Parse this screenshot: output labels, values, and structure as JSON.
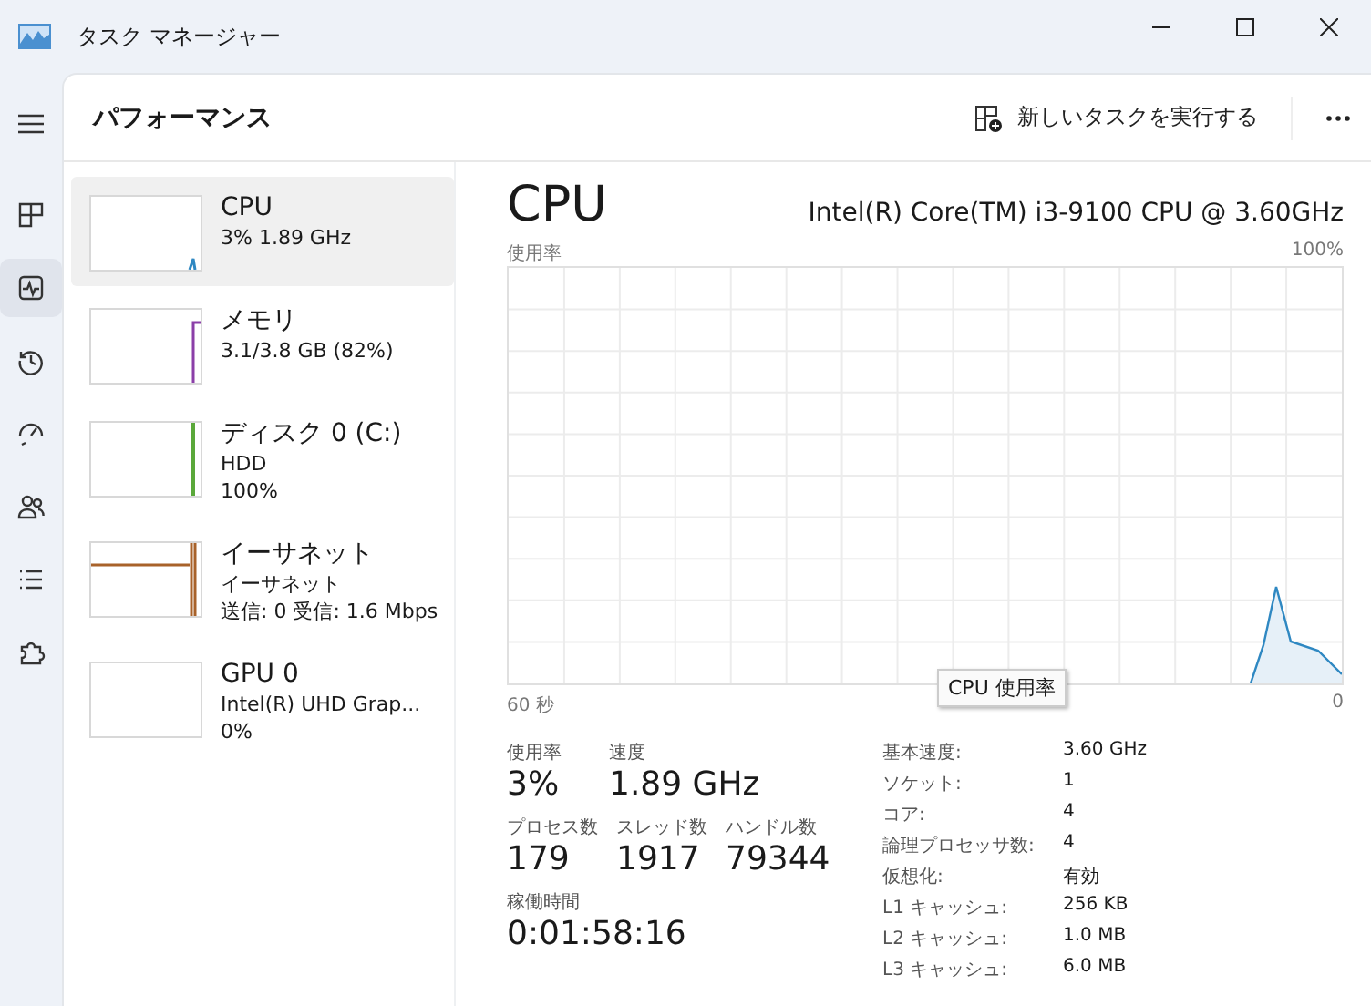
{
  "window": {
    "title": "タスク マネージャー"
  },
  "nav": [
    {
      "selected": false
    },
    {
      "selected": true
    },
    {
      "selected": false
    },
    {
      "selected": false
    },
    {
      "selected": false
    },
    {
      "selected": false
    },
    {
      "selected": false
    }
  ],
  "header": {
    "title": "パフォーマンス",
    "run_task": "新しいタスクを実行する"
  },
  "devices": [
    {
      "kind": "cpu",
      "name": "CPU",
      "lines": [
        "3%  1.89 GHz"
      ],
      "color": "#2f88c2",
      "selected": true
    },
    {
      "kind": "memory",
      "name": "メモリ",
      "lines": [
        "3.1/3.8 GB (82%)"
      ],
      "color": "#8b3fa8",
      "selected": false
    },
    {
      "kind": "disk",
      "name": "ディスク 0 (C:)",
      "lines": [
        "HDD",
        "100%"
      ],
      "color": "#5aa83a",
      "selected": false
    },
    {
      "kind": "ethernet",
      "name": "イーサネット",
      "lines": [
        "イーサネット",
        "送信: 0 受信: 1.6 Mbps"
      ],
      "color": "#a8622a",
      "selected": false
    },
    {
      "kind": "gpu",
      "name": "GPU 0",
      "lines": [
        "Intel(R) UHD Grap...",
        "0%"
      ],
      "selected": false
    }
  ],
  "detail": {
    "title": "CPU",
    "model": "Intel(R) Core(TM) i3-9100 CPU @ 3.60GHz",
    "graph": {
      "label": "使用率",
      "max_label": "100%",
      "time_label": "60 秒",
      "min_label": "0",
      "tooltip": "CPU 使用率"
    },
    "stat_rows": [
      {
        "items": [
          {
            "label": "使用率",
            "value": "3%"
          },
          {
            "label": "速度",
            "value": "1.89 GHz"
          }
        ]
      },
      {
        "items": [
          {
            "label": "プロセス数",
            "value": "179"
          },
          {
            "label": "スレッド数",
            "value": "1917"
          },
          {
            "label": "ハンドル数",
            "value": "79344"
          }
        ]
      },
      {
        "items": [
          {
            "label": "稼働時間",
            "value": "0:01:58:16"
          }
        ]
      }
    ],
    "specs": [
      {
        "label": "基本速度:",
        "value": "3.60 GHz"
      },
      {
        "label": "ソケット:",
        "value": "1"
      },
      {
        "label": "コア:",
        "value": "4"
      },
      {
        "label": "論理プロセッサ数:",
        "value": "4"
      },
      {
        "label": "仮想化:",
        "value": "有効"
      },
      {
        "label": "L1 キャッシュ:",
        "value": "256 KB"
      },
      {
        "label": "L2 キャッシュ:",
        "value": "1.0 MB"
      },
      {
        "label": "L3 キャッシュ:",
        "value": "6.0 MB"
      }
    ]
  }
}
